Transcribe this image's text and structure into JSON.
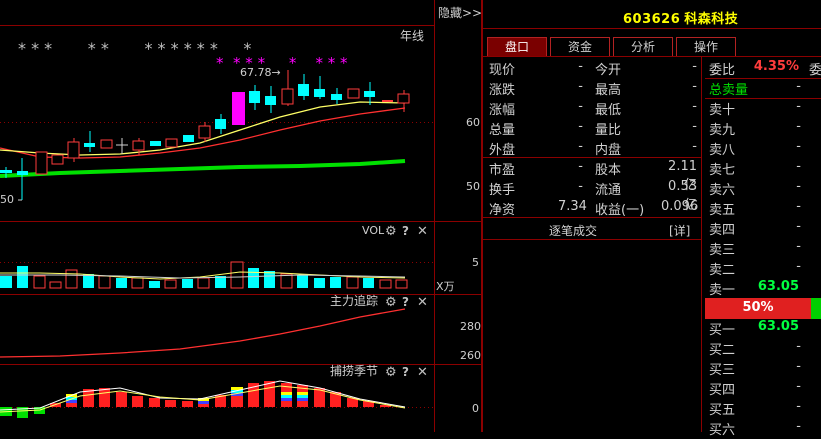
{
  "chart_header": {
    "hide_label": "隐藏>>",
    "period_label": "年线"
  },
  "kline_panel": {
    "price_labels": [
      "60",
      "50"
    ],
    "max_marker": "67.78→",
    "min_marker": "50",
    "stars_gray": "* * *       * *       * * * * * *     *",
    "stars_magenta": "*  * * *     *    * * *"
  },
  "vol_panel": {
    "name": "VOL",
    "scale_value": "5",
    "unit": "X万"
  },
  "main_tracking_panel": {
    "name": "主力追踪",
    "scale_values": [
      "280",
      "260"
    ]
  },
  "season_panel": {
    "name": "捕捞季节",
    "scale_value": "0"
  },
  "indicator_icons": [
    "gear-icon",
    "help-icon",
    "close-icon"
  ],
  "stock": {
    "code": "603626",
    "name": "科森科技"
  },
  "tabs": [
    "盘口",
    "资金",
    "分析",
    "操作"
  ],
  "quote_rows": [
    {
      "l1": "现价",
      "v1": "-",
      "l2": "今开",
      "v2": "-"
    },
    {
      "l1": "涨跌",
      "v1": "-",
      "l2": "最高",
      "v2": "-"
    },
    {
      "l1": "涨幅",
      "v1": "-",
      "l2": "最低",
      "v2": "-"
    },
    {
      "l1": "总量",
      "v1": "-",
      "l2": "量比",
      "v2": "-"
    },
    {
      "l1": "外盘",
      "v1": "-",
      "l2": "内盘",
      "v2": "-"
    },
    {
      "l1": "市盈",
      "v1": "-",
      "l2": "股本",
      "v2": "2.11亿"
    },
    {
      "l1": "换手",
      "v1": "-",
      "l2": "流通",
      "v2": "0.53亿"
    },
    {
      "l1": "净资",
      "v1": "7.34",
      "l2": "收益(一)",
      "v2": "0.096"
    }
  ],
  "trade_detail": {
    "label": "逐笔成交",
    "detail_link": "[详]"
  },
  "order_book": {
    "ratio_label": "委比",
    "ratio_value": "4.35%",
    "ratio_suffix": "委",
    "total_sell_label": "总卖量",
    "total_sell_value": "-",
    "sells": [
      {
        "label": "卖十",
        "price": "-"
      },
      {
        "label": "卖九",
        "price": "-"
      },
      {
        "label": "卖八",
        "price": "-"
      },
      {
        "label": "卖七",
        "price": "-"
      },
      {
        "label": "卖六",
        "price": "-"
      },
      {
        "label": "卖五",
        "price": "-"
      },
      {
        "label": "卖四",
        "price": "-"
      },
      {
        "label": "卖三",
        "price": "-"
      },
      {
        "label": "卖二",
        "price": "-"
      },
      {
        "label": "卖一",
        "price": "63.05"
      }
    ],
    "bar_percent": "50%",
    "buys": [
      {
        "label": "买一",
        "price": "63.05"
      },
      {
        "label": "买二",
        "price": "-"
      },
      {
        "label": "买三",
        "price": "-"
      },
      {
        "label": "买四",
        "price": "-"
      },
      {
        "label": "买五",
        "price": "-"
      },
      {
        "label": "买六",
        "price": "-"
      }
    ]
  },
  "colors": {
    "up": "#ff3c3c",
    "down": "#00ffff",
    "ma_green": "#00e000",
    "ma_yellow": "#ffff66",
    "magenta": "#ff00ff",
    "grid": "#8b0000"
  }
}
